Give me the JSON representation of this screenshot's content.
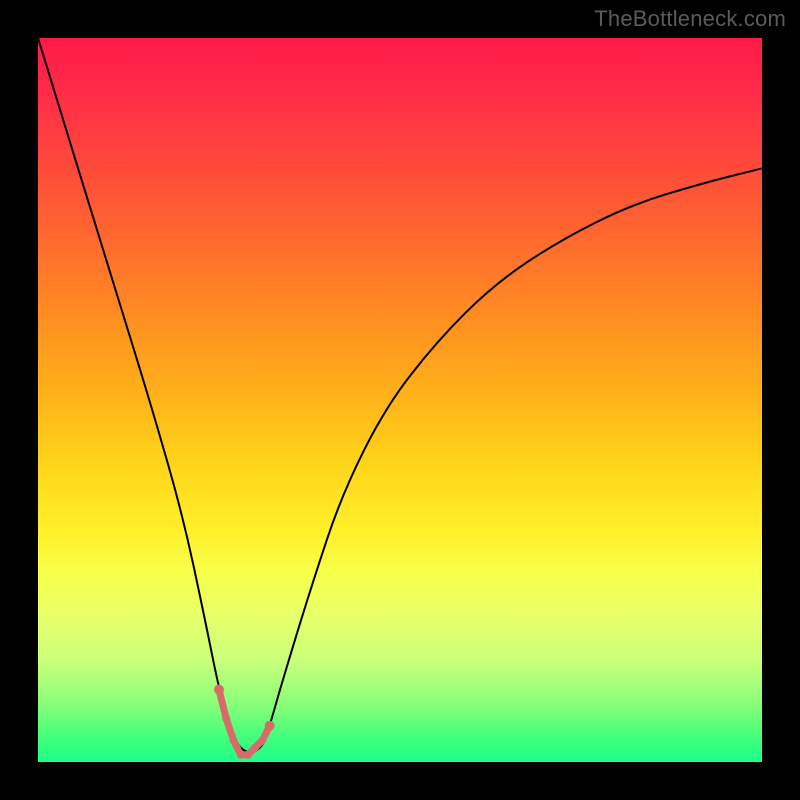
{
  "watermark": "TheBottleneck.com",
  "colors": {
    "background": "#000000",
    "curve": "#000000",
    "marker": "#d86a6a"
  },
  "chart_data": {
    "type": "line",
    "title": "",
    "xlabel": "",
    "ylabel": "",
    "xlim": [
      0,
      100
    ],
    "ylim": [
      0,
      100
    ],
    "grid": false,
    "legend": false,
    "series": [
      {
        "name": "bottleneck-curve",
        "x": [
          0,
          4,
          8,
          12,
          16,
          20,
          23,
          25,
          27,
          29,
          31,
          32,
          34,
          38,
          42,
          48,
          55,
          63,
          72,
          82,
          92,
          100
        ],
        "values": [
          100,
          87,
          74,
          61,
          48,
          34,
          20,
          10,
          3,
          1,
          2,
          5,
          12,
          25,
          37,
          49,
          58,
          66,
          72,
          77,
          80,
          82
        ]
      }
    ],
    "markers": {
      "name": "highlight-near-minimum",
      "x": [
        25,
        26,
        27,
        28,
        29,
        30,
        31,
        32
      ],
      "values": [
        10,
        6,
        3,
        1,
        1,
        2,
        3,
        5
      ]
    },
    "gradient_stops": [
      {
        "pos": 0.0,
        "color": "#ff1a49"
      },
      {
        "pos": 0.5,
        "color": "#ffb81a"
      },
      {
        "pos": 0.78,
        "color": "#f5ff55"
      },
      {
        "pos": 1.0,
        "color": "#1aff88"
      }
    ]
  }
}
